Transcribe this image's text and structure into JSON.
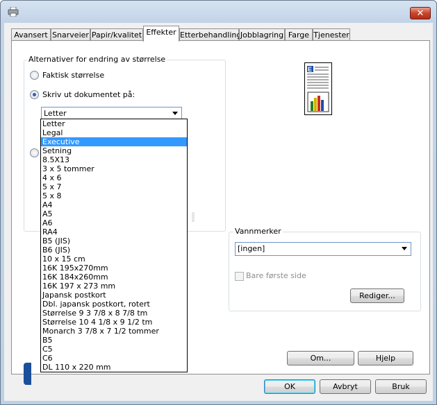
{
  "window": {
    "close_glyph": "✕"
  },
  "tabs": [
    {
      "label": "Avansert"
    },
    {
      "label": "Snarveier"
    },
    {
      "label": "Papir/kvalitet"
    },
    {
      "label": "Effekter"
    },
    {
      "label": "Etterbehandling"
    },
    {
      "label": "Jobblagring"
    },
    {
      "label": "Farge"
    },
    {
      "label": "Tjenester"
    }
  ],
  "resize": {
    "group_label": "Alternativer for endring av størrelse",
    "actual_size_label": "Faktisk størrelse",
    "print_on_label": "Skriv ut dokumentet på:",
    "paper_value": "Letter",
    "options": [
      "Letter",
      "Legal",
      "Executive",
      "Setning",
      "8.5X13",
      "3 x 5 tommer",
      "4 x 6",
      "5 x 7",
      "5 x 8",
      "A4",
      "A5",
      "A6",
      "RA4",
      "B5 (JIS)",
      "B6 (JIS)",
      "10 x 15 cm",
      "16K 195x270mm",
      "16K 184x260mm",
      "16K 197 x 273 mm",
      "Japansk postkort",
      "Dbl. japansk postkort, rotert",
      "Størrelse 9 3 7/8 x 8 7/8 tm",
      "Størrelse 10 4 1/8 x 9 1/2 tm",
      "Monarch 3 7/8 x 7 1/2 tommer",
      "B5",
      "C5",
      "C6",
      "DL 110 x 220 mm"
    ],
    "highlighted_option": "Executive"
  },
  "watermark": {
    "group_label": "Vannmerker",
    "value": "[ingen]",
    "first_page_label": "Bare første side",
    "edit_label": "Rediger..."
  },
  "panel_buttons": {
    "about_label": "Om...",
    "help_label": "Hjelp"
  },
  "footer_buttons": {
    "ok_label": "OK",
    "cancel_label": "Avbryt",
    "apply_label": "Bruk"
  },
  "colors": {
    "accent": "#3399ff",
    "close": "#c9442b",
    "hp_blue": "#1b4f9a"
  }
}
